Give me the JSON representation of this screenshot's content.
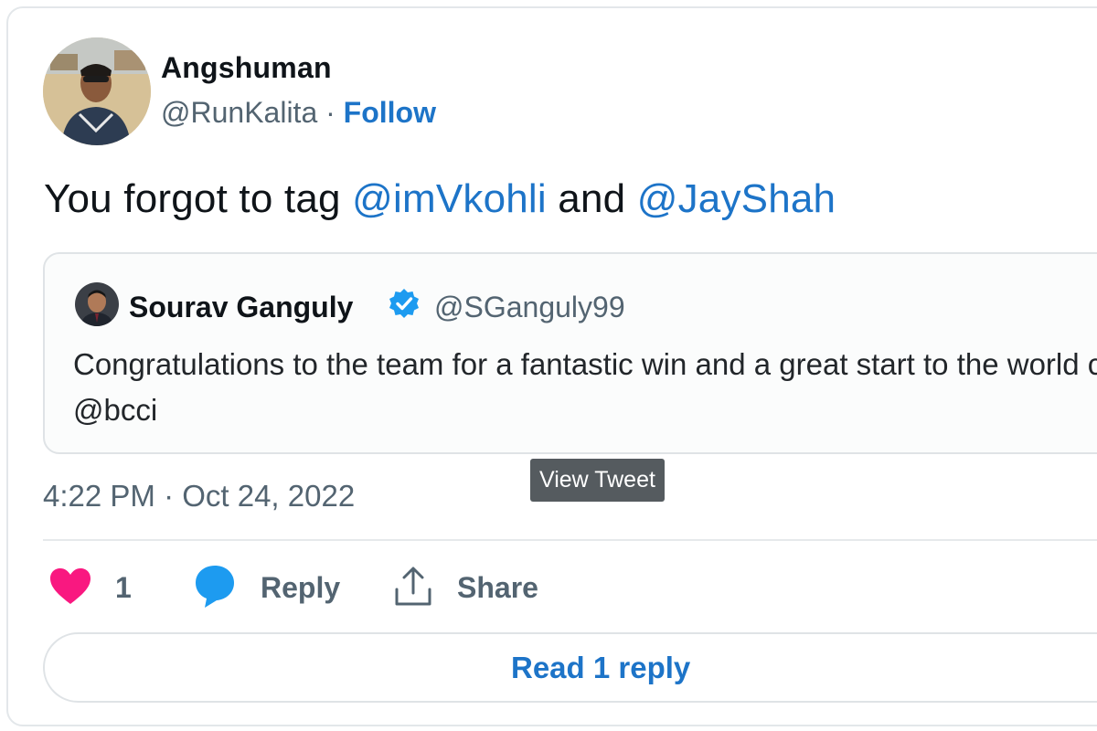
{
  "author": {
    "name": "Angshuman",
    "handle": "@RunKalita",
    "separator": " · ",
    "follow_label": "Follow"
  },
  "tweet": {
    "text_part1": "You forgot to tag ",
    "mention1": "@imVkohli",
    "text_part2": " and ",
    "mention2": "@JayShah"
  },
  "quoted": {
    "name": "Sourav Ganguly",
    "handle": "@SGanguly99",
    "verified": true,
    "text": "Congratulations to the team for a fantastic win and a great start to the world cup @bcci"
  },
  "tooltip": "View Tweet",
  "timestamp": "4:22 PM · Oct 24, 2022",
  "actions": {
    "like_count": "1",
    "reply_label": "Reply",
    "share_label": "Share"
  },
  "read_replies_label": "Read 1 reply",
  "colors": {
    "link": "#1d74c8",
    "heart": "#f91880",
    "reply_icon": "#1d9bf0",
    "muted": "#536471"
  },
  "icons": {
    "like": "heart-icon",
    "reply": "speech-bubble-icon",
    "share": "share-upload-icon",
    "verified": "verified-badge-icon"
  }
}
